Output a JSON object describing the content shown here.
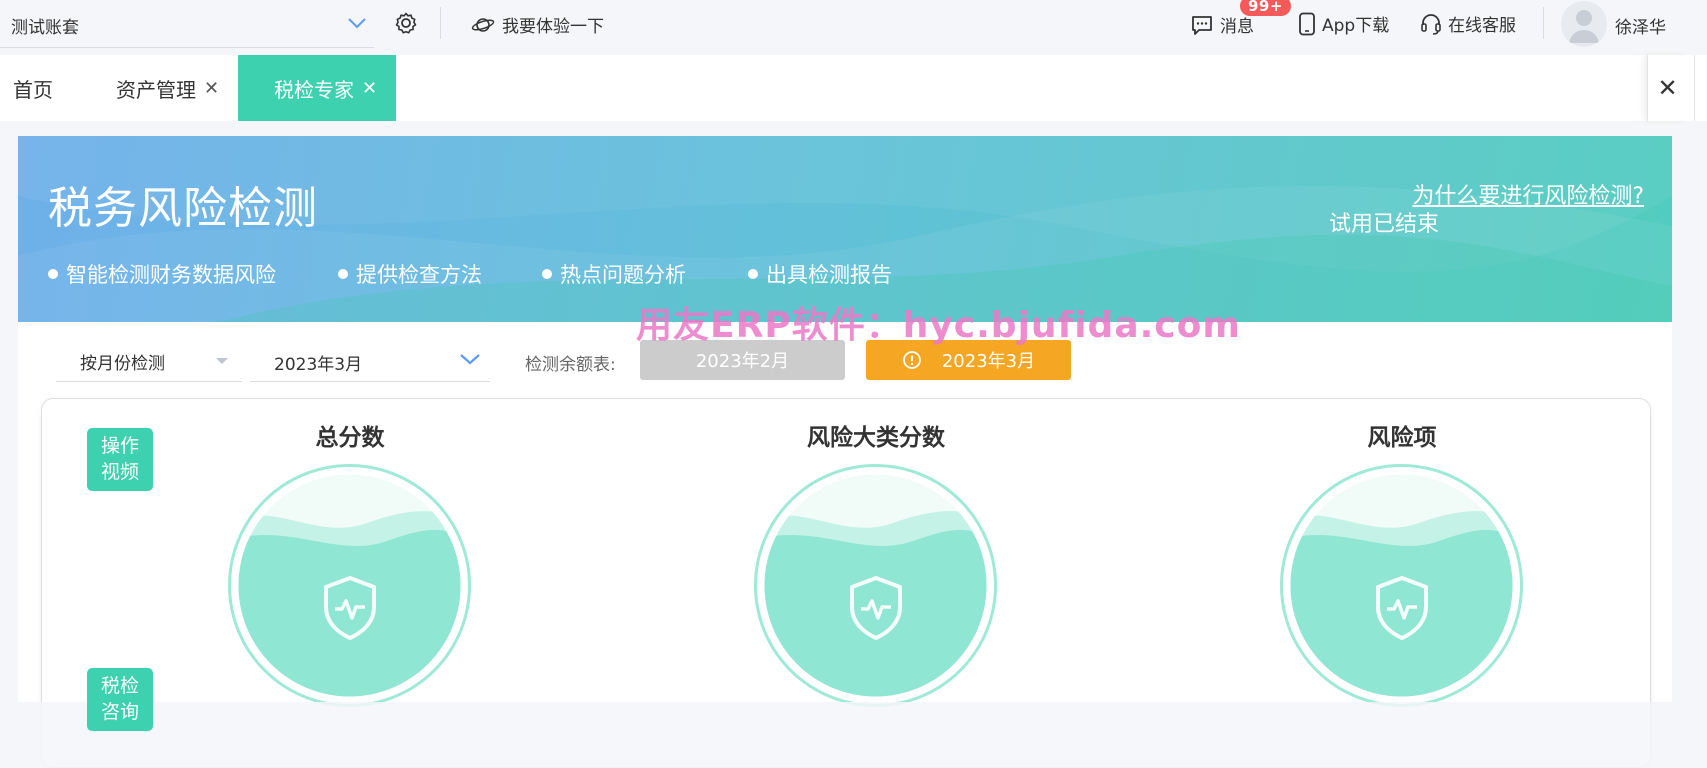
{
  "topbar": {
    "account_name": "测试账套",
    "try_label": "我要体验一下",
    "messages_label": "消息",
    "messages_badge": "99+",
    "app_download_label": "App下载",
    "online_service_label": "在线客服",
    "user_name": "徐泽华"
  },
  "tabs": [
    {
      "label": "首页",
      "closable": false,
      "active": false
    },
    {
      "label": "资产管理",
      "closable": true,
      "active": false
    },
    {
      "label": "税检专家",
      "closable": true,
      "active": true
    }
  ],
  "banner": {
    "title": "税务风险检测",
    "why_link": "为什么要进行风险检测?",
    "trial_status": "试用已结束",
    "features": [
      "智能检测财务数据风险",
      "提供检查方法",
      "热点问题分析",
      "出具检测报告"
    ]
  },
  "watermark": "用友ERP软件：hyc.bjufida.com",
  "filters": {
    "mode_value": "按月份检测",
    "period_value": "2023年3月",
    "quota_label": "检测余额表:",
    "month_buttons": [
      "2023年2月",
      "2023年3月"
    ]
  },
  "side_buttons": [
    "操作\n视频",
    "税检\n咨询"
  ],
  "metrics": [
    "总分数",
    "风险大类分数",
    "风险项"
  ],
  "colors": {
    "accent": "#3ed1b0",
    "warning": "#f5a623",
    "badge": "#f45a5a",
    "disabled": "#cccccc",
    "gauge_fill": "#8fe6d2"
  }
}
